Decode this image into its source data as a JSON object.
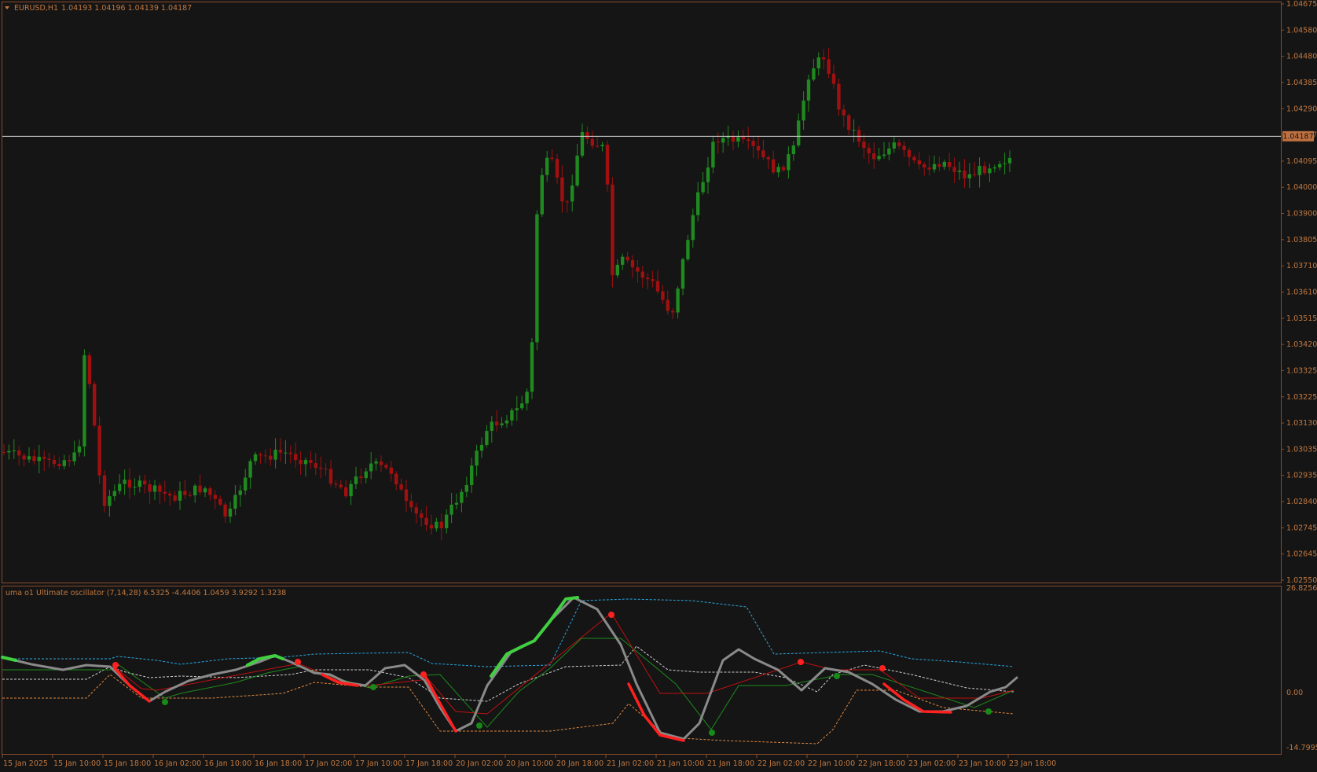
{
  "main_pane": {
    "symbol": "EURUSD,H1",
    "ohlc": "1.04193 1.04196 1.04139 1.04187",
    "collapse_icon": "triangle-down-icon",
    "price_min": 1.0255,
    "price_max": 1.04675,
    "price_labels": [
      "1.04675",
      "1.04580",
      "1.04480",
      "1.04385",
      "1.04290",
      "1.04187",
      "1.04095",
      "1.04000",
      "1.03900",
      "1.03805",
      "1.03710",
      "1.03610",
      "1.03515",
      "1.03420",
      "1.03325",
      "1.03225",
      "1.03130",
      "1.03035",
      "1.02935",
      "1.02840",
      "1.02745",
      "1.02645",
      "1.02550"
    ],
    "current_price": "1.04187",
    "current_price_value": 1.04187
  },
  "indicator_pane": {
    "title": "uma o1 Ultimate oscillator (7,14,28) 6.5325 -4.4406 1.0459 3.9292 1.3238",
    "axis_labels": [
      "26.8256",
      "0.00",
      "-14.7995"
    ],
    "value_max": 26.8256,
    "value_min": -14.7995
  },
  "time_labels": [
    "15 Jan 2025",
    "15 Jan 10:00",
    "15 Jan 18:00",
    "16 Jan 02:00",
    "16 Jan 10:00",
    "16 Jan 18:00",
    "17 Jan 02:00",
    "17 Jan 10:00",
    "17 Jan 18:00",
    "20 Jan 02:00",
    "20 Jan 10:00",
    "20 Jan 18:00",
    "21 Jan 02:00",
    "21 Jan 10:00",
    "21 Jan 18:00",
    "22 Jan 02:00",
    "22 Jan 10:00",
    "22 Jan 18:00",
    "23 Jan 02:00",
    "23 Jan 10:00",
    "23 Jan 18:00"
  ],
  "colors": {
    "background": "#151515",
    "frame": "#8a4a2a",
    "axis_text": "#c07840",
    "bull": "#1f8a1f",
    "bear": "#a01010",
    "current_line": "#d8d8d8",
    "osc_main": "#8a8a8a",
    "osc_up": "#40d040",
    "osc_down": "#ff2020",
    "band_upper": "#2aa8e0",
    "band_mid": "#d0d0d0",
    "band_lower": "#e08840"
  }
}
